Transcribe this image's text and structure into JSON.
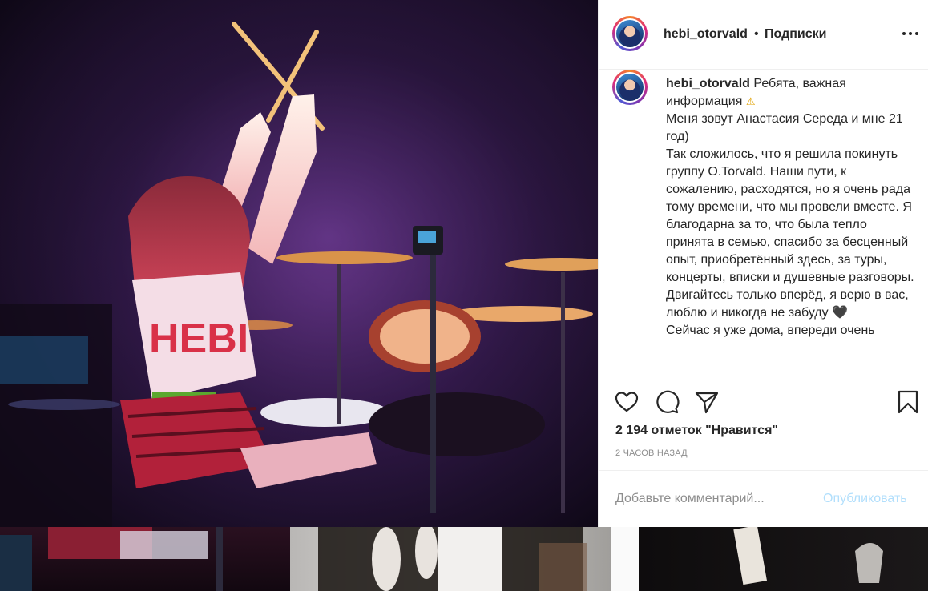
{
  "post": {
    "username": "hebi_otorvald",
    "separator": "•",
    "follow_status": "Подписки",
    "more_icon": "more-horizontal-icon"
  },
  "caption": {
    "username": "hebi_otorvald",
    "text_start": "Ребята, важная информация",
    "warning_icon": "⚠",
    "lines": [
      "Меня зовут Анастасия Середа и мне 21 год)",
      "Так сложилось, что я решила покинуть группу O.Torvald. Наши пути, к сожалению, расходятся, но я очень рада тому времени, что мы провели вместе. Я благодарна за то, что была тепло принята в семью, спасибо за бесценный опыт, приобретённый здесь, за туры, концерты, вписки и душевные разговоры. Двигайтесь только вперёд, я верю в вас, люблю и никогда не забуду 🖤",
      "Сейчас я уже дома, впереди очень"
    ]
  },
  "photo": {
    "shirt_text": "HEBI"
  },
  "actions": {
    "like_icon": "heart-icon",
    "comment_icon": "comment-icon",
    "share_icon": "paper-plane-icon",
    "save_icon": "bookmark-icon",
    "likes_text": "2 194 отметок \"Нравится\"",
    "time_text": "2 ЧАСОВ НАЗАД"
  },
  "comment": {
    "placeholder": "Добавьте комментарий...",
    "publish_label": "Опубликовать"
  },
  "colors": {
    "accent_disabled": "#b2dffc",
    "text": "#262626",
    "muted": "#8e8e8e"
  }
}
